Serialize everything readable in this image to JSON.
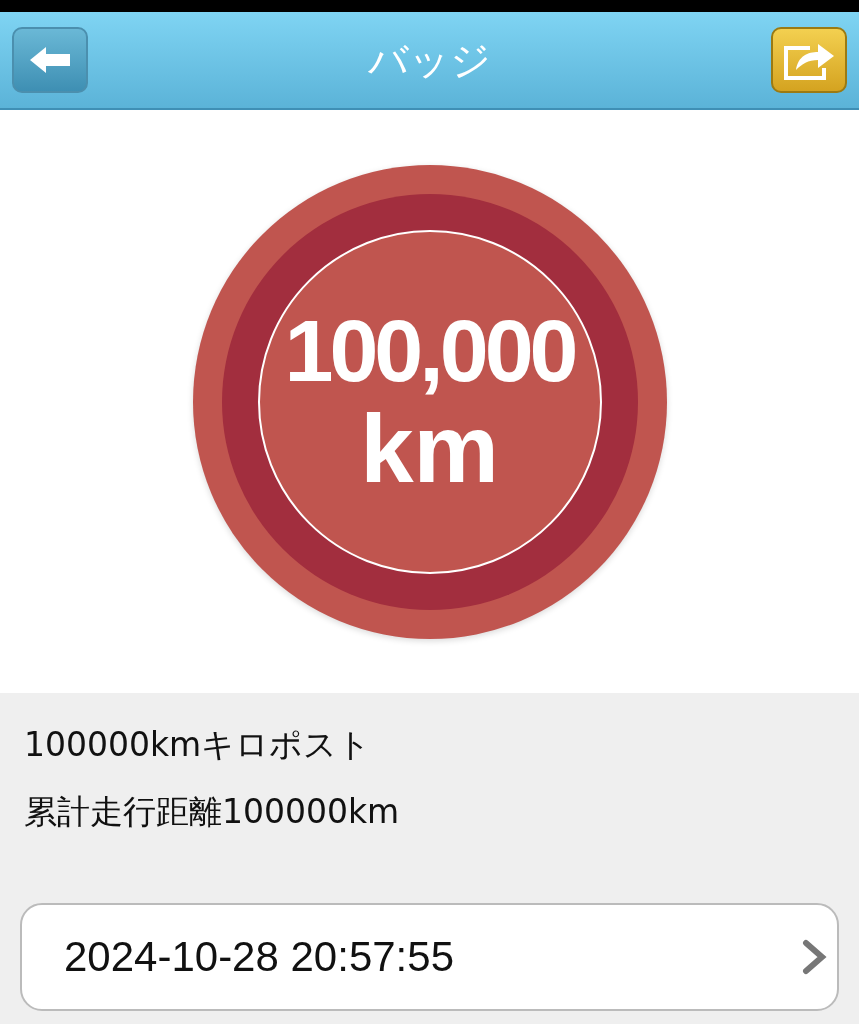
{
  "header": {
    "title": "バッジ"
  },
  "badge": {
    "value": "100,000",
    "unit": "km"
  },
  "details": {
    "name": "100000kmキロポスト",
    "description": "累計走行距離100000km"
  },
  "date_row": {
    "value": "2024-10-28 20:57:55"
  }
}
